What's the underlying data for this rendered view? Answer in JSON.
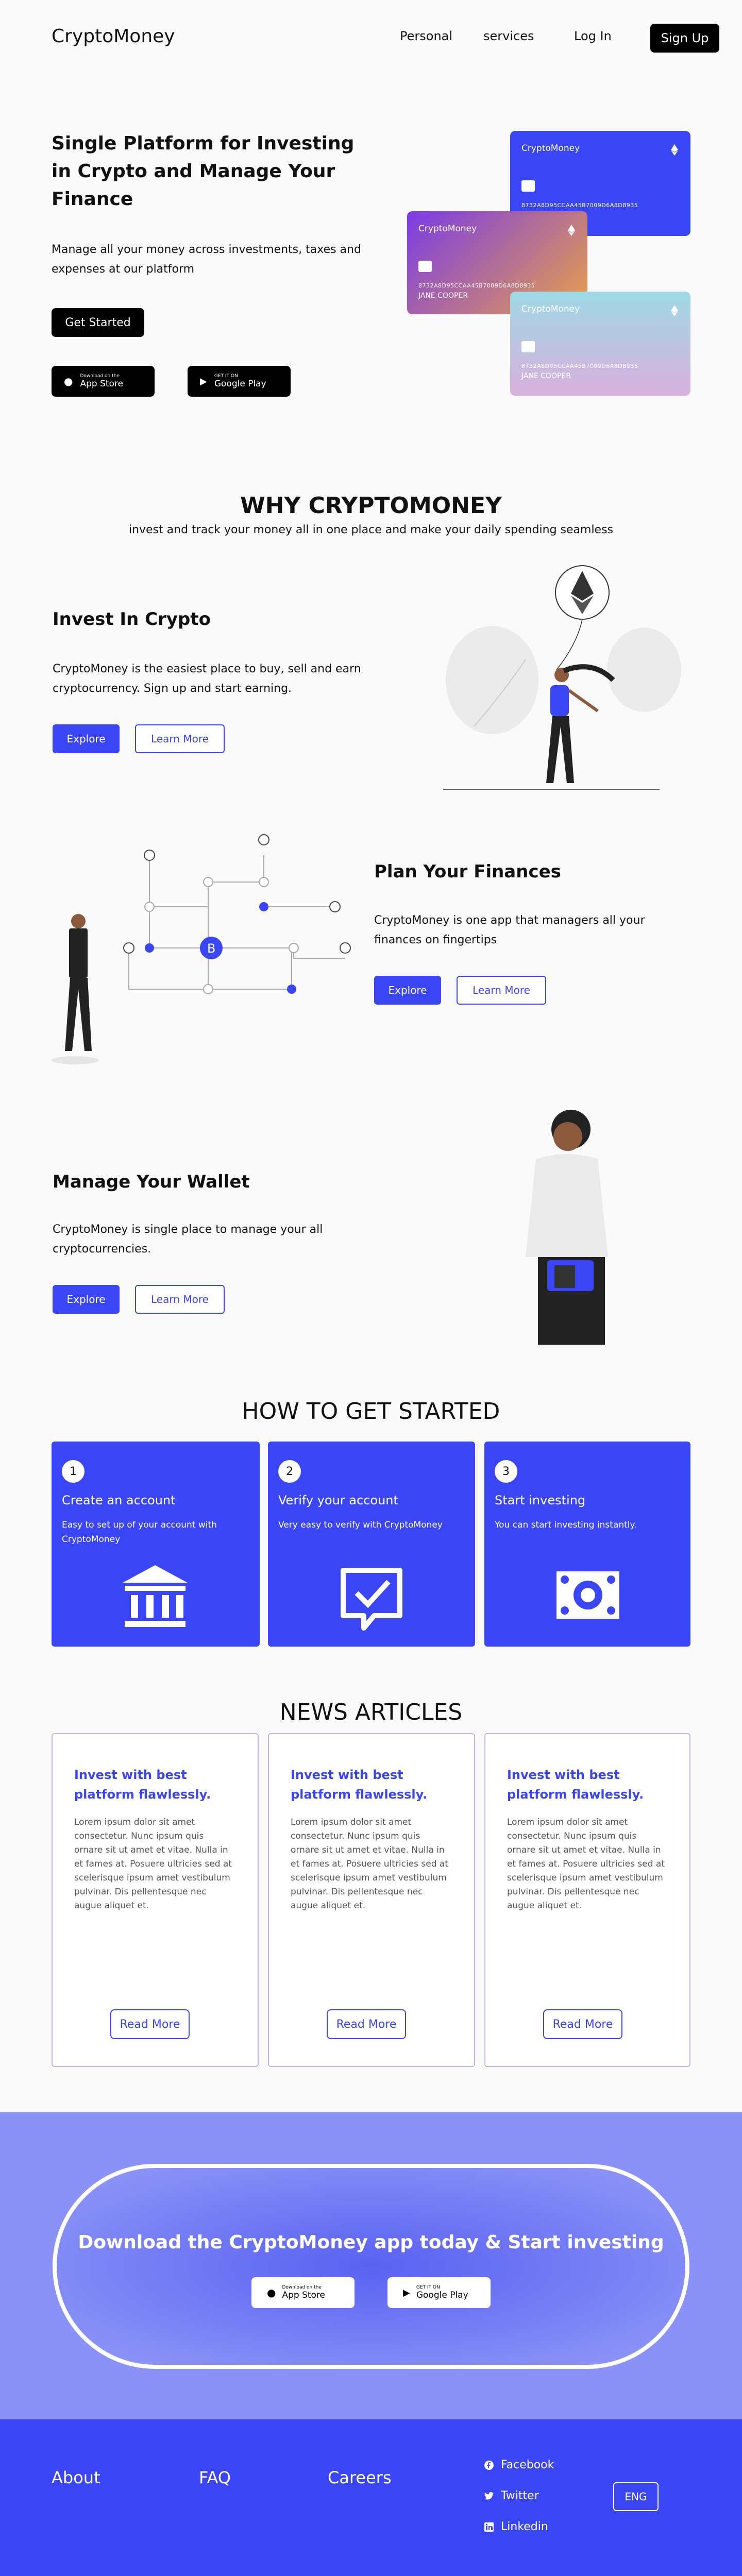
{
  "nav": {
    "logo": "CryptoMoney",
    "links": [
      "Personal",
      "services",
      "Log In"
    ],
    "signup": "Sign Up"
  },
  "hero": {
    "title": "Single Platform for Investing in Crypto and Manage Your Finance",
    "subtitle": "Manage all your money across investments, taxes and expenses at our platform",
    "cta": "Get Started",
    "app_store_small": "Download on the",
    "app_store_big": "App Store",
    "play_small": "GET IT ON",
    "play_big": "Google Play",
    "cards": [
      {
        "brand": "CryptoMoney",
        "number": "8732A8D95CCAA45B7009D6A8D8935",
        "holder": "",
        "color_start": "#3a45f5",
        "color_end": "#3a45f5"
      },
      {
        "brand": "CryptoMoney",
        "number": "8732A8D95CCAA45B7009D6A8D8935",
        "holder": "JANE COOPER",
        "color_start": "#7a3be6",
        "color_end": "#e8a04a"
      },
      {
        "brand": "CryptoMoney",
        "number": "8732A8D95CCAA45B7009D6A8D8935",
        "holder": "JANE COOPER",
        "color_start": "#9fd9e6",
        "color_end": "#d8b0dc"
      }
    ]
  },
  "why": {
    "title": "WHY CRYPTOMONEY",
    "subtitle": "invest and track your money all in one place and make your daily spending seamless"
  },
  "features": [
    {
      "title": "Invest In Crypto",
      "text": "CryptoMoney is the easiest place to buy, sell and earn cryptocurrency. Sign up and start earning.",
      "primary": "Explore",
      "secondary": "Learn More"
    },
    {
      "title": "Plan Your Finances",
      "text": "CryptoMoney is one app that managers all your finances on fingertips",
      "primary": "Explore",
      "secondary": "Learn More"
    },
    {
      "title": "Manage Your Wallet",
      "text": "CryptoMoney is single place to manage your all cryptocurrencies.",
      "primary": "Explore",
      "secondary": "Learn More"
    }
  ],
  "steps": {
    "title": "HOW TO GET STARTED",
    "items": [
      {
        "num": "1",
        "title": "Create an account",
        "desc": "Easy to set up of your account with CryptoMoney"
      },
      {
        "num": "2",
        "title": "Verify your account",
        "desc": "Very easy to verify with CryptoMoney"
      },
      {
        "num": "3",
        "title": "Start investing",
        "desc": "You can start investing instantly."
      }
    ]
  },
  "news": {
    "title": "NEWS ARTICLES",
    "items": [
      {
        "title": "Invest with best platform flawlessly.",
        "body": "Lorem ipsum dolor sit amet consectetur. Nunc ipsum quis ornare sit ut amet et vitae. Nulla in et fames at. Posuere ultricies sed at scelerisque ipsum amet vestibulum pulvinar. Dis pellentesque nec augue aliquet et.",
        "cta": "Read More"
      },
      {
        "title": "Invest with best platform flawlessly.",
        "body": "Lorem ipsum dolor sit amet consectetur. Nunc ipsum quis ornare sit ut amet et vitae. Nulla in et fames at. Posuere ultricies sed at scelerisque ipsum amet vestibulum pulvinar. Dis pellentesque nec augue aliquet et.",
        "cta": "Read More"
      },
      {
        "title": "Invest with best platform flawlessly.",
        "body": "Lorem ipsum dolor sit amet consectetur. Nunc ipsum quis ornare sit ut amet et vitae. Nulla in et fames at. Posuere ultricies sed at scelerisque ipsum amet vestibulum pulvinar. Dis pellentesque nec augue aliquet et.",
        "cta": "Read More"
      }
    ]
  },
  "download": {
    "title": "Download the CryptoMoney app today & Start investing",
    "app_store_small": "Download on the",
    "app_store_big": "App Store",
    "play_small": "GET IT ON",
    "play_big": "Google Play"
  },
  "footer": {
    "links": [
      "About",
      "FAQ",
      "Careers"
    ],
    "social": [
      "Facebook",
      "Twitter",
      "Linkedin"
    ],
    "lang": "ENG"
  },
  "colors": {
    "accent": "#3a45f5",
    "banner": "#8a92f7",
    "footer": "#3a45f5"
  }
}
